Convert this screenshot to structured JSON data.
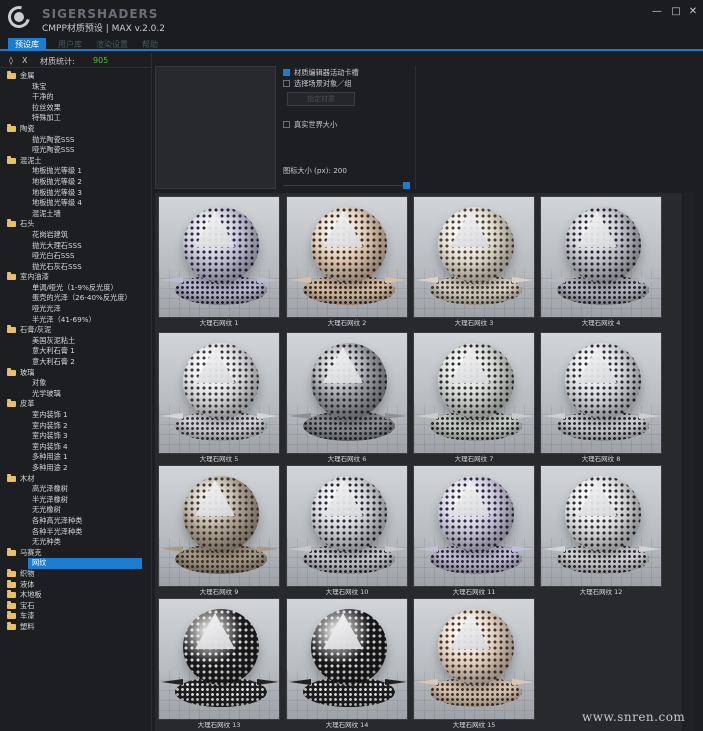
{
  "window": {
    "brand": "SIGERSHADERS",
    "title": "CMPP材质预设 | MAX v.2.0.2",
    "minimize": "—",
    "maximize": "□",
    "close": "✕"
  },
  "tabs": [
    {
      "label": "预设库",
      "active": true
    },
    {
      "label": "用户库",
      "active": false
    },
    {
      "label": "渲染设置",
      "active": false
    },
    {
      "label": "帮助",
      "active": false
    }
  ],
  "left": {
    "expand_icon": "◊",
    "close_icon": "X",
    "stats_label": "材质统计:",
    "stats_value": "905",
    "tree": [
      {
        "type": "cat",
        "label": "金属"
      },
      {
        "type": "leaf",
        "label": "珠宝"
      },
      {
        "type": "leaf",
        "label": "干净的"
      },
      {
        "type": "leaf",
        "label": "拉丝效果"
      },
      {
        "type": "leaf",
        "label": "特殊加工"
      },
      {
        "type": "cat",
        "label": "陶瓷"
      },
      {
        "type": "leaf",
        "label": "抛光陶瓷SSS"
      },
      {
        "type": "leaf",
        "label": "哑光陶瓷SSS"
      },
      {
        "type": "cat",
        "label": "混泥土"
      },
      {
        "type": "leaf",
        "label": "地板抛光等级 1"
      },
      {
        "type": "leaf",
        "label": "地板抛光等级 2"
      },
      {
        "type": "leaf",
        "label": "地板抛光等级 3"
      },
      {
        "type": "leaf",
        "label": "地板抛光等级 4"
      },
      {
        "type": "leaf",
        "label": "混泥土墙"
      },
      {
        "type": "cat",
        "label": "石头"
      },
      {
        "type": "leaf",
        "label": "花岗岩建筑"
      },
      {
        "type": "leaf",
        "label": "抛光大理石SSS"
      },
      {
        "type": "leaf",
        "label": "哑光白石SSS"
      },
      {
        "type": "leaf",
        "label": "抛光石灰石SSS"
      },
      {
        "type": "cat",
        "label": "室内油漆"
      },
      {
        "type": "leaf",
        "label": "单调/哑光（1-9%反光度）"
      },
      {
        "type": "leaf",
        "label": "蛋壳的光泽（26-40%反光度）"
      },
      {
        "type": "leaf",
        "label": "哑光光泽"
      },
      {
        "type": "leaf",
        "label": "半光泽（41-69%）"
      },
      {
        "type": "cat",
        "label": "石膏/灰泥"
      },
      {
        "type": "leaf",
        "label": "美国灰泥粘土"
      },
      {
        "type": "leaf",
        "label": "意大利石膏 1"
      },
      {
        "type": "leaf",
        "label": "意大利石膏 2"
      },
      {
        "type": "cat",
        "label": "玻璃"
      },
      {
        "type": "leaf",
        "label": "对象"
      },
      {
        "type": "leaf",
        "label": "光学玻璃"
      },
      {
        "type": "cat",
        "label": "皮革"
      },
      {
        "type": "leaf",
        "label": "室内装饰 1"
      },
      {
        "type": "leaf",
        "label": "室内装饰 2"
      },
      {
        "type": "leaf",
        "label": "室内装饰 3"
      },
      {
        "type": "leaf",
        "label": "室内装饰 4"
      },
      {
        "type": "leaf",
        "label": "多种用途 1"
      },
      {
        "type": "leaf",
        "label": "多种用途 2"
      },
      {
        "type": "cat",
        "label": "木材"
      },
      {
        "type": "leaf",
        "label": "高光泽橡树"
      },
      {
        "type": "leaf",
        "label": "半光泽橡树"
      },
      {
        "type": "leaf",
        "label": "无光橡树"
      },
      {
        "type": "leaf",
        "label": "各种高光泽种类"
      },
      {
        "type": "leaf",
        "label": "各种半光泽种类"
      },
      {
        "type": "leaf",
        "label": "无光种类"
      },
      {
        "type": "cat",
        "label": "马赛克"
      },
      {
        "type": "selected",
        "label": "网纹"
      },
      {
        "type": "cat",
        "label": "织物"
      },
      {
        "type": "cat",
        "label": "液体"
      },
      {
        "type": "cat",
        "label": "木地板"
      },
      {
        "type": "cat",
        "label": "宝石"
      },
      {
        "type": "cat",
        "label": "车漆"
      },
      {
        "type": "cat",
        "label": "塑料"
      }
    ]
  },
  "options": {
    "cb1_label": "材质编辑器活动卡槽",
    "cb1_checked": true,
    "cb2_label": "选择场景对象／组",
    "cb2_checked": false,
    "apply_button": "指定材质",
    "cb3_label": "真实世界大小",
    "cb3_checked": false,
    "size_label": "图标大小 (px):",
    "size_value": "200"
  },
  "thumbnails": [
    {
      "label": "大理石网纹 1",
      "sphere": "#c9c7dc",
      "dot": "#2a2a3a",
      "base": "#bdbbd2"
    },
    {
      "label": "大理石网纹 2",
      "sphere": "#e2c9b0",
      "dot": "#3a3030",
      "base": "#d8bfa5"
    },
    {
      "label": "大理石网纹 3",
      "sphere": "#e5ddd0",
      "dot": "#4a443c",
      "base": "#dcd3c5"
    },
    {
      "label": "大理石网纹 4",
      "sphere": "#c4c4ce",
      "dot": "#2a2a36",
      "base": "#b7b7c2"
    },
    {
      "label": "大理石网纹 5",
      "sphere": "#e3e3e5",
      "dot": "#3a3a40",
      "base": "#d6d6da"
    },
    {
      "label": "大理石网纹 6",
      "sphere": "#9ea0a6",
      "dot": "#2b2c30",
      "base": "#8e9096"
    },
    {
      "label": "大理石网纹 7",
      "sphere": "#d7dad6",
      "dot": "#2d302e",
      "base": "#caceca"
    },
    {
      "label": "大理石网纹 8",
      "sphere": "#dcdde0",
      "dot": "#2e2f34",
      "base": "#cfd0d4"
    },
    {
      "label": "大理石网纹 9",
      "sphere": "#b5a897",
      "dot": "#3e372e",
      "base": "#a89a88"
    },
    {
      "label": "大理石网纹 10",
      "sphere": "#d5d6dc",
      "dot": "#2a2b32",
      "base": "#c8c9d0"
    },
    {
      "label": "大理石网纹 11",
      "sphere": "#d1cde2",
      "dot": "#2f2c3e",
      "base": "#c4bfd6"
    },
    {
      "label": "大理石网纹 12",
      "sphere": "#e1e1e3",
      "dot": "#303034",
      "base": "#d4d4d7"
    },
    {
      "label": "大理石网纹 13",
      "sphere": "#1c1c1e",
      "dot": "#e8e8e8",
      "base": "#222224"
    },
    {
      "label": "大理石网纹 14",
      "sphere": "#1a1a1c",
      "dot": "#e6e6e6",
      "base": "#202022"
    },
    {
      "label": "大理石网纹 15",
      "sphere": "#e8d4c4",
      "dot": "#4a3a30",
      "base": "#dcc8b6"
    }
  ],
  "watermark": "www.snren.com"
}
